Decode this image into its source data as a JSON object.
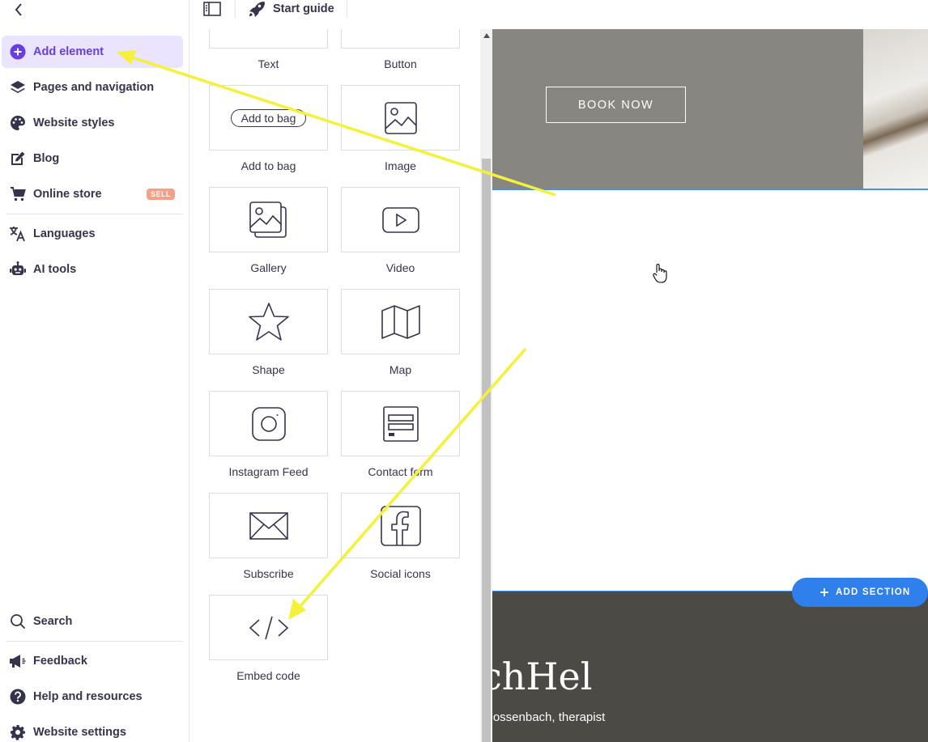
{
  "sidebar": {
    "items": [
      {
        "label": "Add element",
        "icon": "add-circle-icon",
        "active": true
      },
      {
        "label": "Pages and navigation",
        "icon": "layers-icon"
      },
      {
        "label": "Website styles",
        "icon": "palette-icon"
      },
      {
        "label": "Blog",
        "icon": "edit-icon"
      },
      {
        "label": "Online store",
        "icon": "cart-icon",
        "badge": "SELL"
      },
      {
        "label": "Languages",
        "icon": "translate-icon"
      },
      {
        "label": "AI tools",
        "icon": "robot-icon"
      }
    ],
    "bottom_items": [
      {
        "label": "Search",
        "icon": "search-icon"
      },
      {
        "label": "Feedback",
        "icon": "megaphone-icon"
      },
      {
        "label": "Help and resources",
        "icon": "help-icon"
      },
      {
        "label": "Website settings",
        "icon": "gear-icon"
      }
    ]
  },
  "topbar": {
    "start_guide_label": "Start guide"
  },
  "elements": [
    {
      "label": "Text",
      "icon": "text-icon"
    },
    {
      "label": "Button",
      "icon": "button-icon"
    },
    {
      "label": "Add to bag",
      "icon": "add-to-bag-icon",
      "pill_text": "Add to bag"
    },
    {
      "label": "Image",
      "icon": "image-icon"
    },
    {
      "label": "Gallery",
      "icon": "gallery-icon"
    },
    {
      "label": "Video",
      "icon": "video-icon"
    },
    {
      "label": "Shape",
      "icon": "star-icon"
    },
    {
      "label": "Map",
      "icon": "map-icon"
    },
    {
      "label": "Instagram Feed",
      "icon": "instagram-icon"
    },
    {
      "label": "Contact form",
      "icon": "contact-form-icon"
    },
    {
      "label": "Subscribe",
      "icon": "envelope-icon"
    },
    {
      "label": "Social icons",
      "icon": "facebook-icon"
    },
    {
      "label": "Embed code",
      "icon": "code-icon"
    }
  ],
  "canvas": {
    "book_now_label": "BOOK NOW",
    "add_section_label": "ADD SECTION",
    "brand_text": "chHel",
    "therapist_text": "Dossenbach, therapist"
  },
  "colors": {
    "accent": "#673de6",
    "active_bg": "#ebe4ff",
    "hero_bg": "#878680",
    "dark_section_bg": "#4b4a45",
    "add_section_bg": "#2f80ed",
    "annotation_arrow": "#f4f13b"
  }
}
